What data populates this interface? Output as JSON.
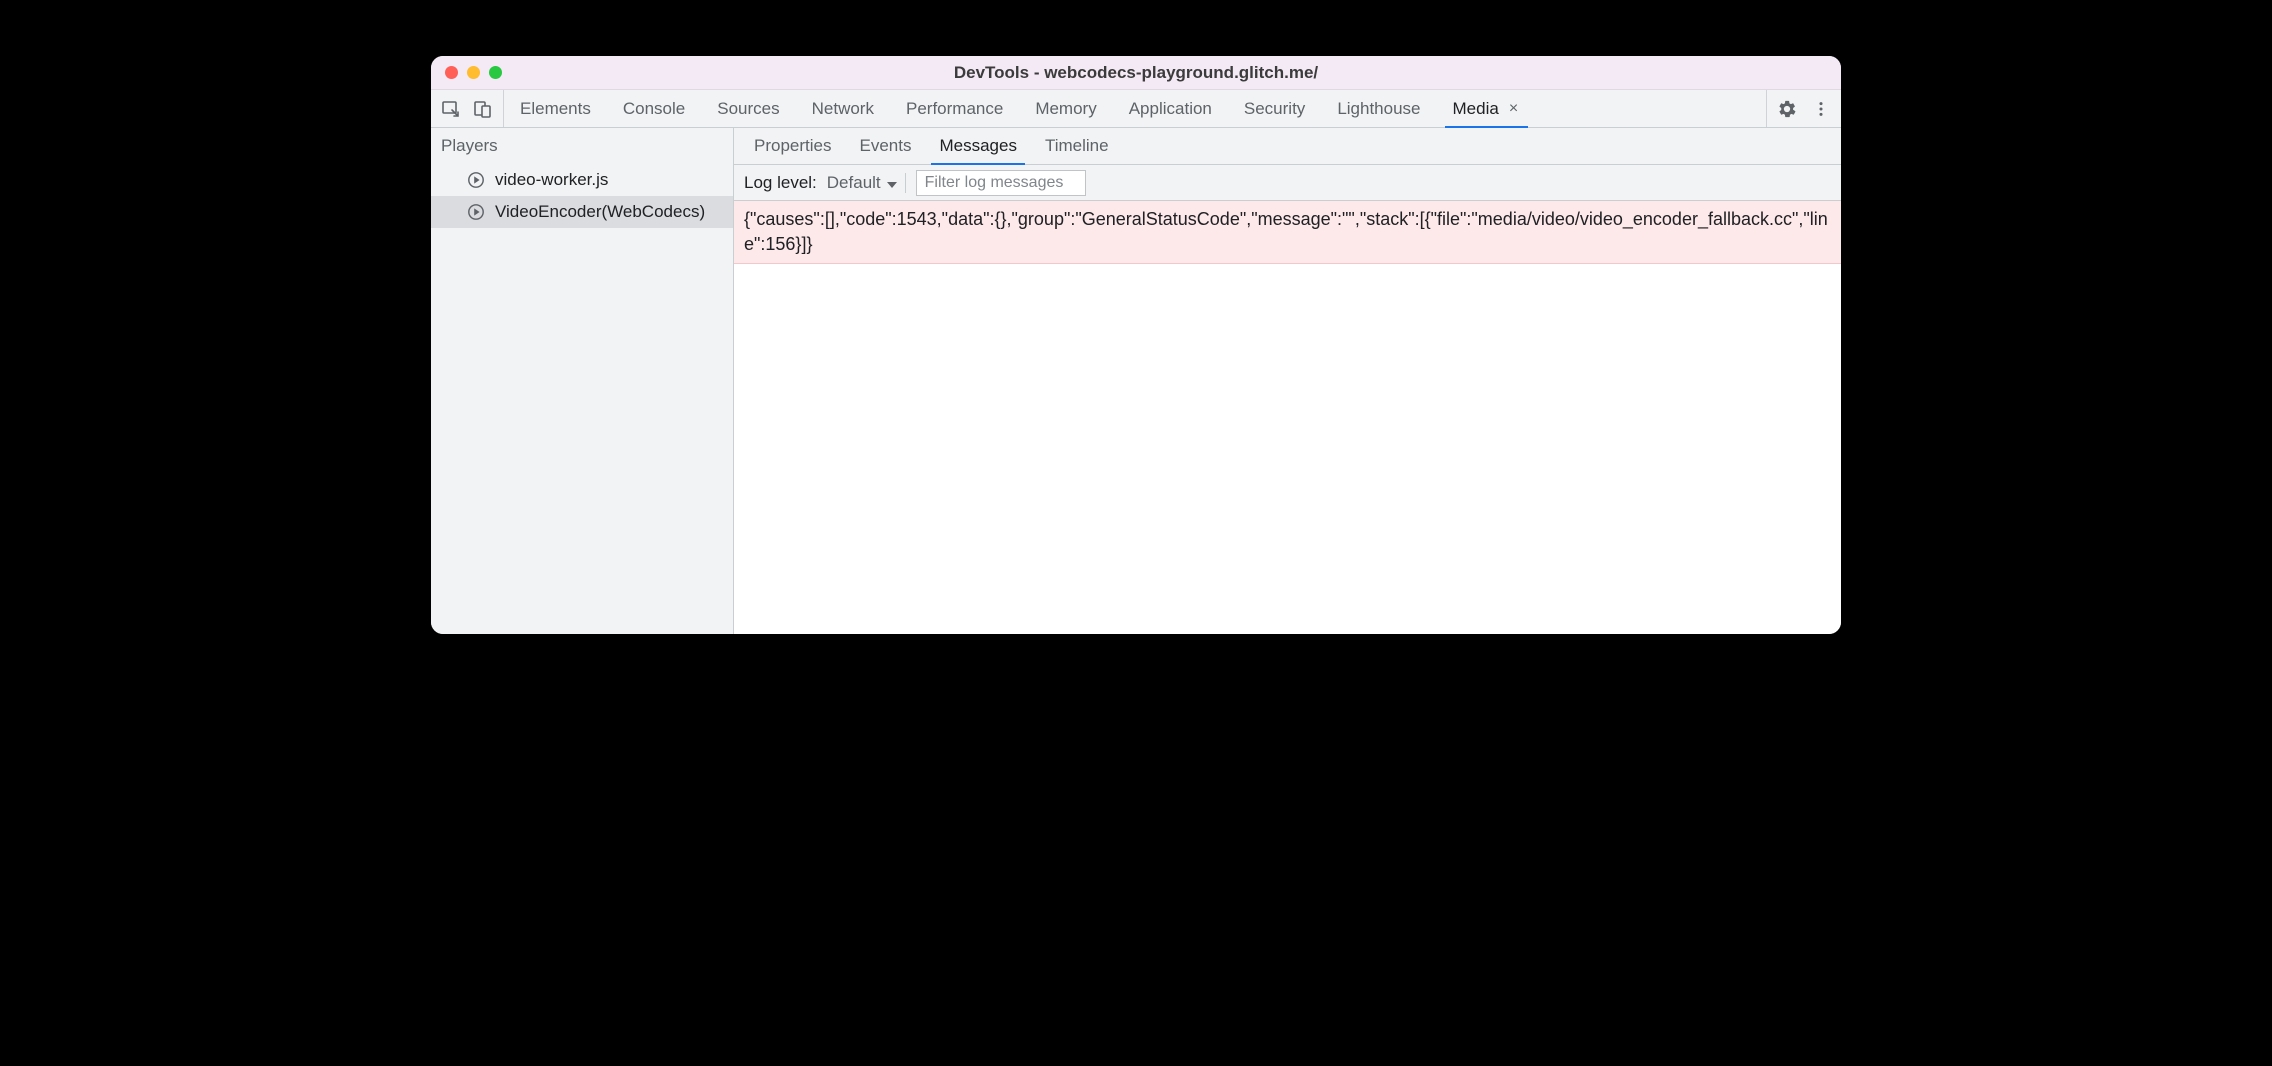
{
  "window": {
    "title": "DevTools - webcodecs-playground.glitch.me/"
  },
  "toolbar": {
    "tabs": [
      {
        "label": "Elements",
        "active": false,
        "closable": false
      },
      {
        "label": "Console",
        "active": false,
        "closable": false
      },
      {
        "label": "Sources",
        "active": false,
        "closable": false
      },
      {
        "label": "Network",
        "active": false,
        "closable": false
      },
      {
        "label": "Performance",
        "active": false,
        "closable": false
      },
      {
        "label": "Memory",
        "active": false,
        "closable": false
      },
      {
        "label": "Application",
        "active": false,
        "closable": false
      },
      {
        "label": "Security",
        "active": false,
        "closable": false
      },
      {
        "label": "Lighthouse",
        "active": false,
        "closable": false
      },
      {
        "label": "Media",
        "active": true,
        "closable": true
      }
    ]
  },
  "sidebar": {
    "header": "Players",
    "players": [
      {
        "label": "video-worker.js",
        "selected": false
      },
      {
        "label": "VideoEncoder(WebCodecs)",
        "selected": true
      }
    ]
  },
  "subtabs": [
    {
      "label": "Properties",
      "active": false
    },
    {
      "label": "Events",
      "active": false
    },
    {
      "label": "Messages",
      "active": true
    },
    {
      "label": "Timeline",
      "active": false
    }
  ],
  "filterbar": {
    "loglevel_label": "Log level:",
    "loglevel_value": "Default",
    "filter_placeholder": "Filter log messages"
  },
  "messages": [
    {
      "text": "{\"causes\":[],\"code\":1543,\"data\":{},\"group\":\"GeneralStatusCode\",\"message\":\"\",\"stack\":[{\"file\":\"media/video/video_encoder_fallback.cc\",\"line\":156}]}"
    }
  ]
}
